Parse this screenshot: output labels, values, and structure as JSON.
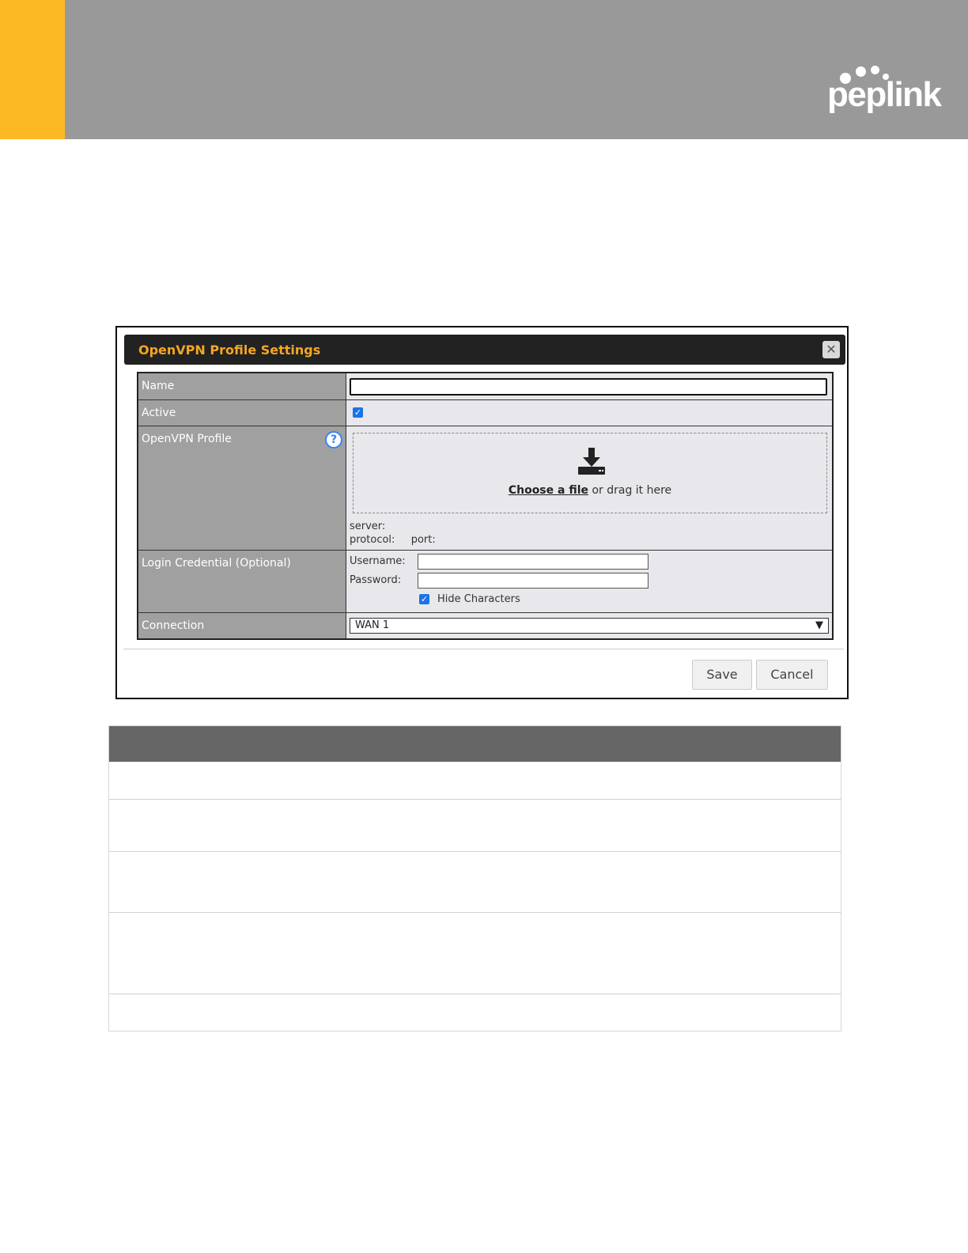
{
  "header": {
    "accent_color": "#fdb924",
    "band_color": "#999999",
    "logo_text": "peplink"
  },
  "dialog": {
    "title": "OpenVPN Profile Settings",
    "close_icon": "close-icon",
    "fields": {
      "name_label": "Name",
      "name_value": "",
      "active_label": "Active",
      "active_checked": true,
      "profile_label": "OpenVPN Profile",
      "profile_help_icon": "help-icon",
      "dropzone_link": "Choose a file",
      "dropzone_rest": "or drag it here",
      "server_label": "server:",
      "protocol_label": "protocol:",
      "port_label": "port:",
      "login_label": "Login Credential (Optional)",
      "username_label": "Username:",
      "password_label": "Password:",
      "hide_chars_label": "Hide Characters",
      "hide_chars_checked": true,
      "connection_label": "Connection",
      "connection_value": "WAN 1"
    },
    "buttons": {
      "save": "Save",
      "cancel": "Cancel"
    }
  },
  "lower_table": {
    "header_color": "#666666",
    "rows": [
      "",
      "",
      "",
      "",
      ""
    ]
  }
}
